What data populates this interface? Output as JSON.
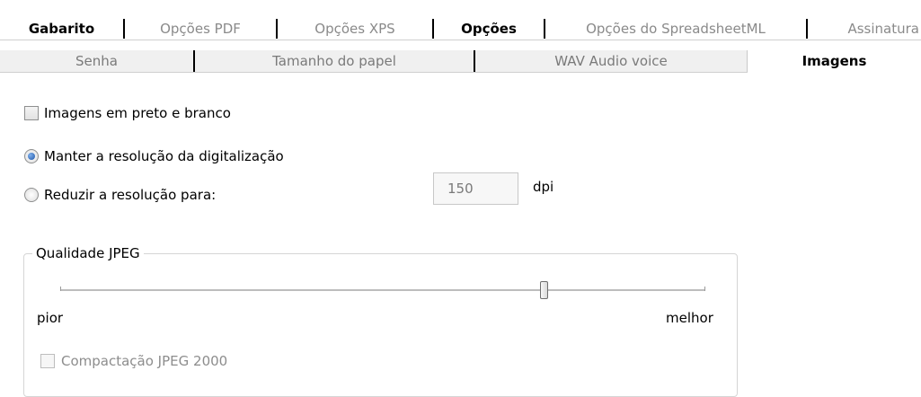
{
  "tabs_row1": [
    {
      "label": "Gabarito",
      "bold": true
    },
    {
      "label": "Opções PDF",
      "bold": false
    },
    {
      "label": "Opções XPS",
      "bold": false
    },
    {
      "label": "Opções",
      "bold": true
    },
    {
      "label": "Opções do SpreadsheetML",
      "bold": false
    },
    {
      "label": "Assinatura",
      "bold": false
    }
  ],
  "tabs_row2": [
    {
      "label": "Senha",
      "active": false
    },
    {
      "label": "Tamanho do papel",
      "active": false
    },
    {
      "label": "WAV Audio voice",
      "active": false
    },
    {
      "label": "Imagens",
      "active": true
    }
  ],
  "options": {
    "grayscale_label": "Imagens em preto e branco",
    "grayscale_checked": false,
    "keep_resolution_label": "Manter a resolução da digitalização",
    "reduce_resolution_label": "Reduzir a resolução para:",
    "selected_resolution_option": "keep",
    "dpi_value": "150",
    "dpi_unit": "dpi"
  },
  "jpeg": {
    "group_title": "Qualidade JPEG",
    "min_label": "pior",
    "max_label": "melhor",
    "quality_fraction": 0.75,
    "jpeg2000_label": "Compactação JPEG 2000",
    "jpeg2000_checked": false,
    "jpeg2000_enabled": false
  },
  "colors": {
    "active_tab_bg": "#ffffff",
    "inactive_tab_bg": "#f0f0f0",
    "radio_dot": "#1e55a8"
  }
}
